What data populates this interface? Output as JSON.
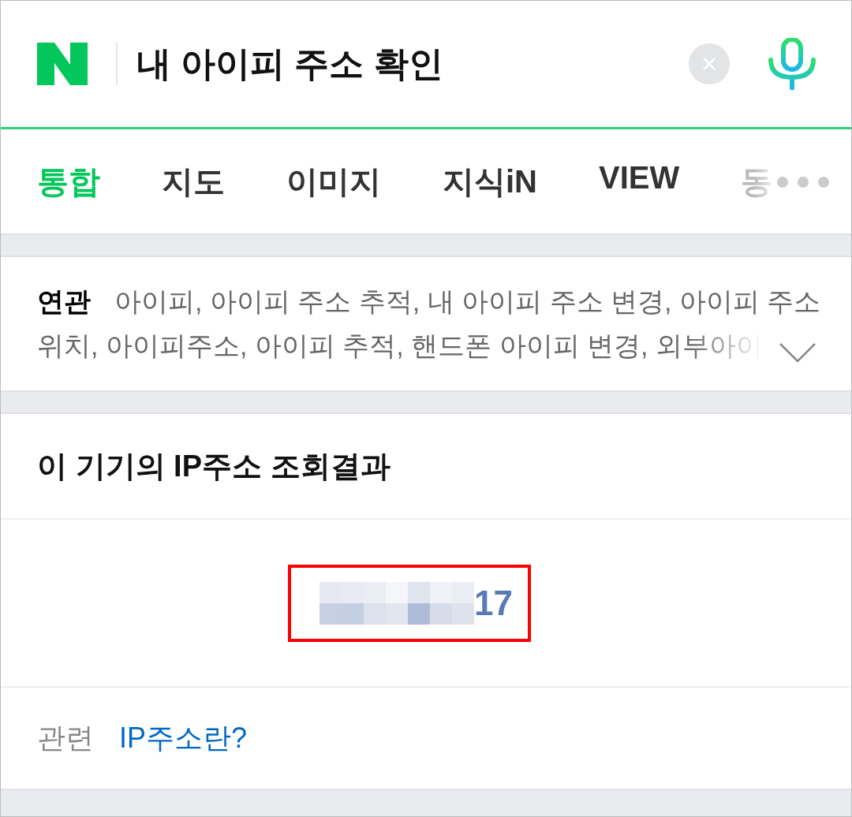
{
  "search": {
    "query": "내 아이피 주소 확인"
  },
  "tabs": [
    {
      "label": "통합",
      "selected": true,
      "faded": false
    },
    {
      "label": "지도",
      "selected": false,
      "faded": false
    },
    {
      "label": "이미지",
      "selected": false,
      "faded": false
    },
    {
      "label": "지식iN",
      "selected": false,
      "faded": false
    },
    {
      "label": "VIEW",
      "selected": false,
      "faded": false
    },
    {
      "label": "동",
      "selected": false,
      "faded": true
    }
  ],
  "related_searches": {
    "label": "연관",
    "lines": [
      "아이피, 아이피 주소 추적, 내 아이피 주소 변경, 아이피 주소",
      "위치, 아이피주소, 아이피 추적, 핸드폰 아이피 변경, 외부아이"
    ],
    "expanded": false
  },
  "ip_result": {
    "title": "이 기기의 IP주소 조회결과",
    "address_visible": "17",
    "redacted": true,
    "highlighted": true
  },
  "related_link": {
    "label": "관련",
    "link": "IP주소란?"
  }
}
